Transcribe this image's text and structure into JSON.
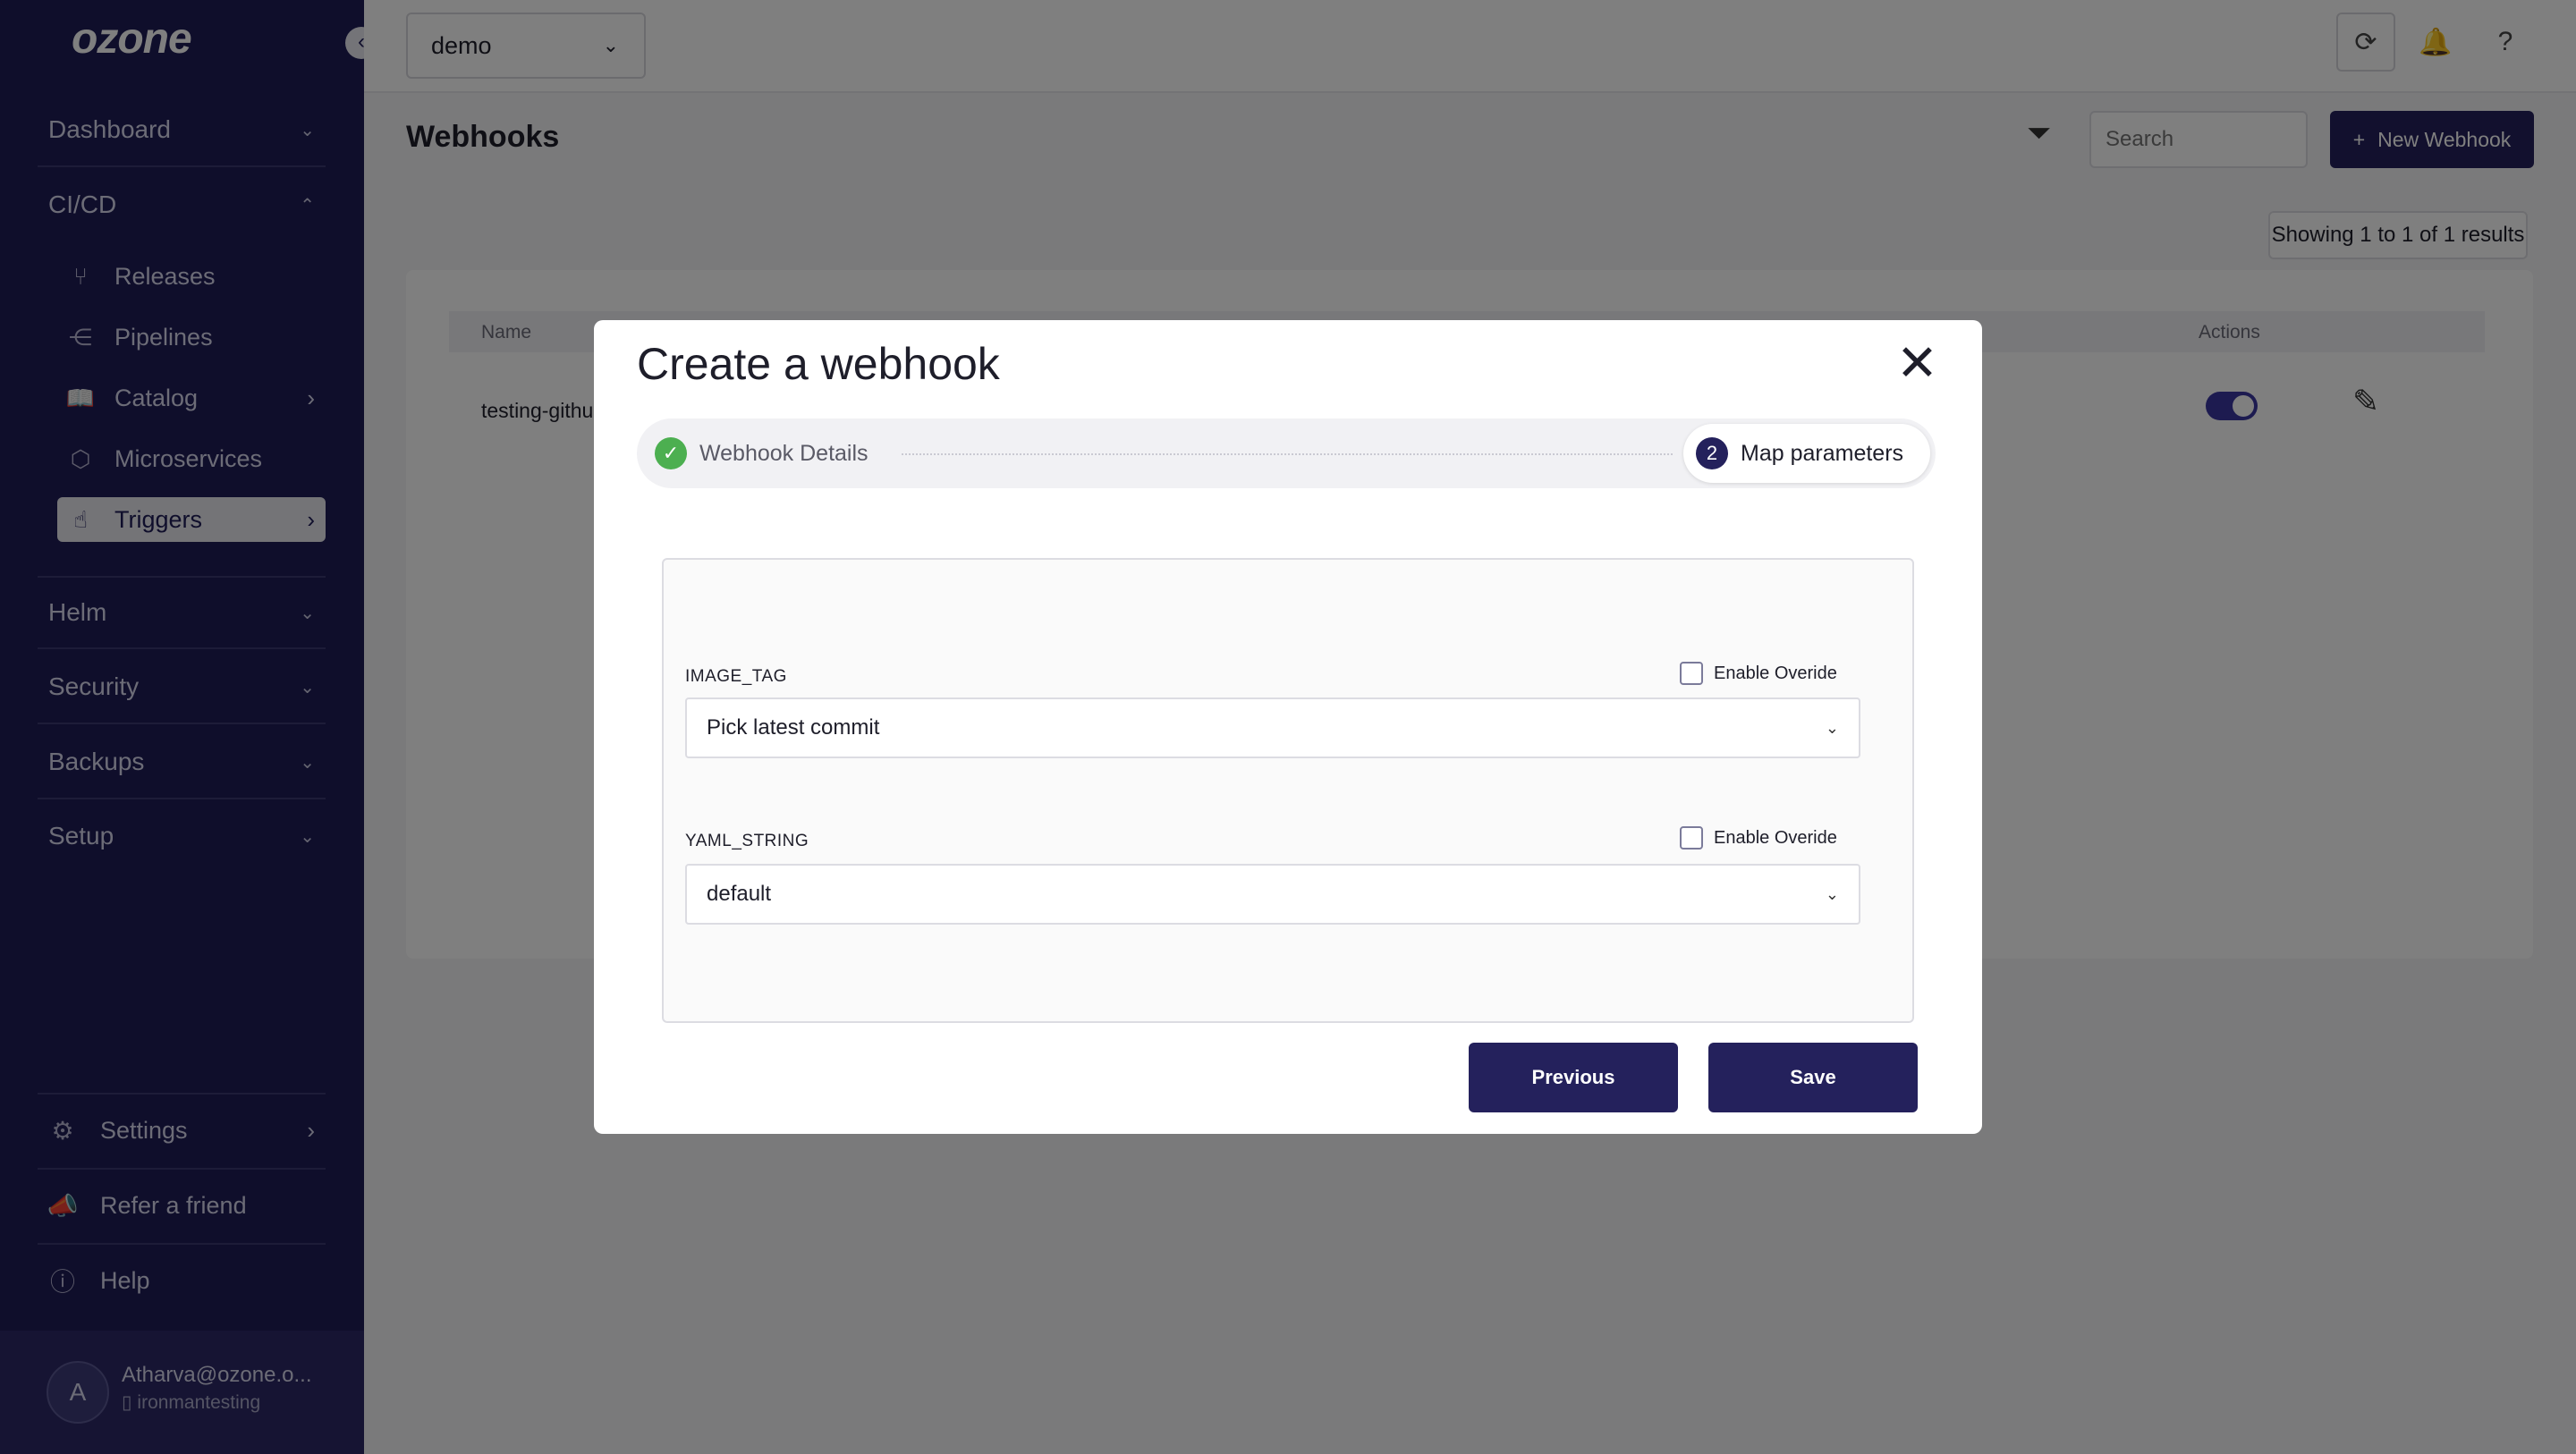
{
  "sidebar": {
    "logo": "ozone",
    "collapse_icon": "chevron-left-icon",
    "sections": {
      "dashboard": "Dashboard",
      "cicd": "CI/CD",
      "helm": "Helm",
      "security": "Security",
      "backups": "Backups",
      "setup": "Setup"
    },
    "cicd_items": {
      "releases": "Releases",
      "pipelines": "Pipelines",
      "catalog": "Catalog",
      "microservices": "Microservices",
      "triggers": "Triggers"
    },
    "bottom": {
      "settings": "Settings",
      "refer": "Refer a friend",
      "help": "Help"
    },
    "user": {
      "initial": "A",
      "email": "Atharva@ozone.o...",
      "org": "ironmantesting"
    }
  },
  "topbar": {
    "environment": "demo"
  },
  "page": {
    "title": "Webhooks",
    "search_placeholder": "Search",
    "new_button": "New Webhook",
    "new_button_icon": "+",
    "results": "Showing 1 to 1 of 1 results",
    "table": {
      "col_name": "Name",
      "col_actions": "Actions",
      "row_name": "testing-githu",
      "row_enabled": true
    }
  },
  "modal": {
    "title": "Create a webhook",
    "step1_label": "Webhook Details",
    "step2_number": "2",
    "step2_label": "Map parameters",
    "params": [
      {
        "name": "IMAGE_TAG",
        "value": "Pick latest commit",
        "override_label": "Enable Overide"
      },
      {
        "name": "YAML_STRING",
        "value": "default",
        "override_label": "Enable Overide"
      }
    ],
    "previous_button": "Previous",
    "save_button": "Save"
  },
  "colors": {
    "sidebar_bg": "#1f1c57",
    "primary": "#24215c",
    "success": "#4caf50"
  }
}
